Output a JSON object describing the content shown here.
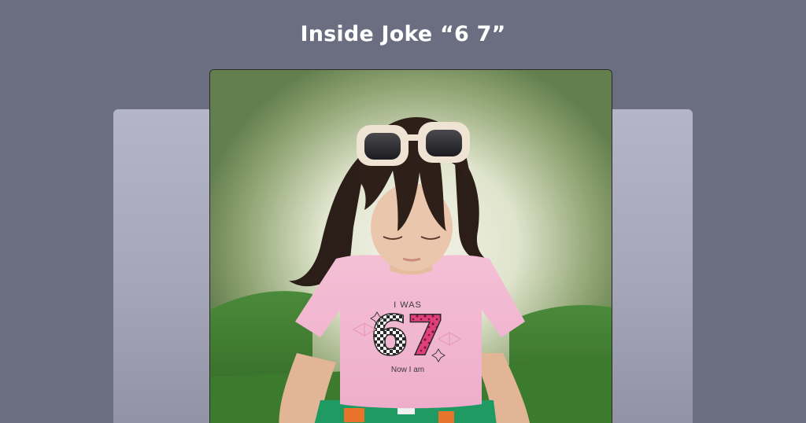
{
  "header": {
    "title": "Inside Joke “6 7”"
  },
  "photo": {
    "subject": "child-in-pink-tshirt",
    "shirt_text_top": "I WAS",
    "shirt_number_left": "6",
    "shirt_number_right": "7",
    "shirt_text_bottom": "Now I am"
  },
  "colors": {
    "page_background": "#6b6d80",
    "title_color": "#ffffff",
    "back_card": "#a9abbd",
    "backdrop_green": "#6f8a5a",
    "backdrop_glow": "#f3f1e6",
    "grass": "#3f7a30",
    "shirt_pink": "#f2b6cf",
    "number_pink": "#e0407a",
    "hair": "#2b1d18",
    "skin": "#e9c3a8",
    "sunglasses_frame": "#efe3d4"
  }
}
